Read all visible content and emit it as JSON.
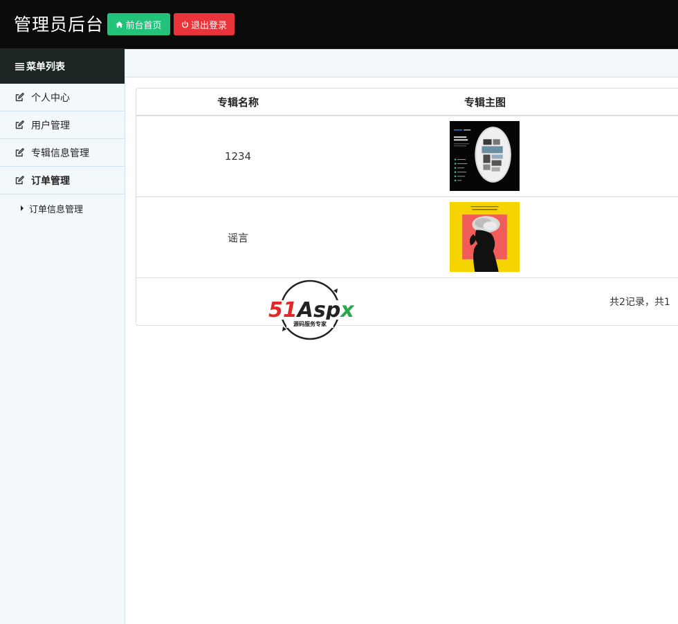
{
  "header": {
    "title": "管理员后台",
    "home_button": "前台首页",
    "logout_button": "退出登录"
  },
  "sidebar": {
    "title": "菜单列表",
    "items": [
      {
        "label": "个人中心"
      },
      {
        "label": "用户管理"
      },
      {
        "label": "专辑信息管理"
      },
      {
        "label": "订单管理"
      }
    ],
    "sub_items": [
      {
        "label": "订单信息管理"
      }
    ]
  },
  "table": {
    "columns": [
      "专辑名称",
      "专辑主图"
    ],
    "rows": [
      {
        "name": "1234",
        "image_icon": "album-cover-disc-sleeve"
      },
      {
        "name": "谣言",
        "image_icon": "album-cover-boys-dont-cry"
      }
    ],
    "pager": "共2记录，共1"
  },
  "watermark": {
    "brand": "51Aspx",
    "tagline": "源码服务专家"
  },
  "colors": {
    "header_bg": "#0b0b0b",
    "home_button": "#21c27a",
    "logout_button": "#e8343a",
    "sidebar_bg": "#f3f8fb",
    "menu_header_bg": "#1b2624"
  }
}
